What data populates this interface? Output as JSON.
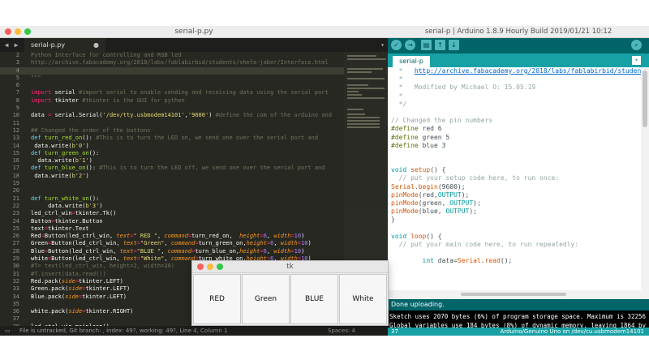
{
  "sublime": {
    "title": "serial-p.py",
    "tab": {
      "label": "serial-p.py",
      "modified_marker": "●"
    },
    "line_numbers": [
      "2",
      "3",
      "4",
      "5",
      "6",
      "7",
      "8",
      "9",
      "10",
      "11",
      "12",
      "13",
      "14",
      "15",
      "16",
      "17",
      "18",
      "19",
      "20",
      "21",
      "22",
      "23",
      "24",
      "25",
      "26",
      "27",
      "28",
      "29",
      "30",
      "31",
      "32",
      "33",
      "34",
      "35",
      "36",
      "37",
      "38",
      "39"
    ],
    "status": {
      "left": "File is untracked, Git branch: , index: 49?, working: 49?, Line 4, Column 1",
      "right": "Spaces: 4"
    }
  },
  "arduino": {
    "title": "serial-p | Arduino 1.8.9 Hourly Build 2019/01/21 10:12",
    "tab_label": "serial-p",
    "code_lines": [
      "  *   http://archive.fabacademy.org/2018/labs/fablabirbid/students/sh",
      "  *",
      "  *   Modified by Michael O: 15.05.19",
      "  *",
      "  */",
      "",
      "// Changed the pin numbers",
      "#define red 6",
      "#define green 5",
      "#define blue 3",
      "",
      "",
      "void setup() {",
      "  // put your setup code here, to run once:",
      "Serial.begin(9600);",
      "pinMode(red,OUTPUT);",
      "pinMode(green, OUTPUT);",
      "pinMode(blue, OUTPUT);",
      "}",
      "",
      "void loop() {",
      "  // put your main code here, to run repeatedly:",
      "",
      "        int data=Serial.read();"
    ],
    "status_message": "Done uploading.",
    "console_lines": [
      "Sketch uses 2070 bytes (6%) of program storage space. Maximum is 32256",
      "Global variables use 184 bytes (8%) of dynamic memory, leaving 1864 by"
    ],
    "footer_left": "37",
    "footer_right": "Arduino/Genuino Uno on /dev/cu.usbmodem14101"
  },
  "tk": {
    "title": "tk",
    "buttons": [
      "RED",
      "Green",
      "BLUE",
      "White"
    ]
  },
  "icons": {
    "verify": "✓",
    "upload": "→",
    "new": "▤",
    "open": "↑",
    "save": "↓",
    "serial_monitor": "⌕",
    "dropdown": "▾"
  },
  "colors": {
    "sublime_bg": "#272822",
    "arduino_teal": "#006468",
    "arduino_tab": "#17a1a5"
  }
}
